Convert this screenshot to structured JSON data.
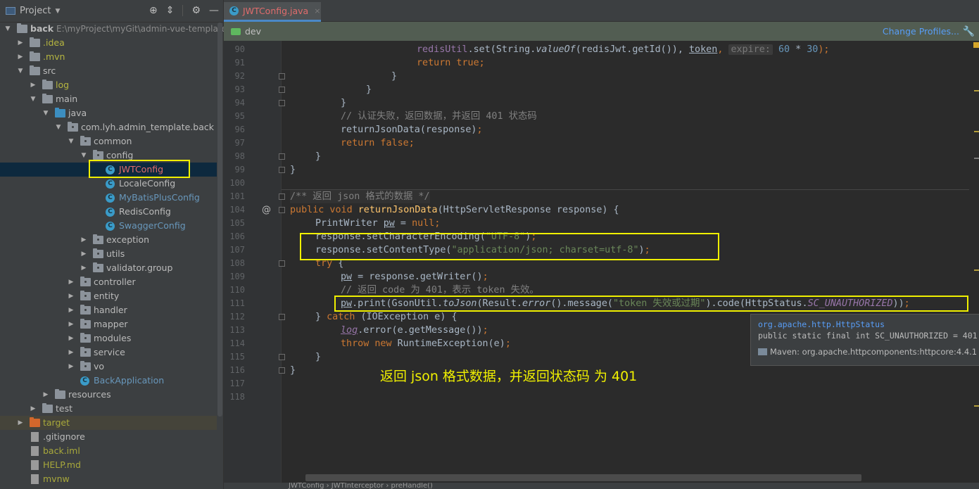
{
  "project_panel": {
    "title": "Project",
    "tools": [
      "locate-icon",
      "collapse-icon",
      "gear-icon",
      "minimize-icon"
    ],
    "tree": [
      {
        "label": "back",
        "path": "E:\\myProject\\myGit\\admin-vue-template\\b",
        "depth": 0,
        "expanded": true,
        "icon": "module"
      },
      {
        "label": ".idea",
        "depth": 1,
        "expanded": false,
        "icon": "folder",
        "color": "yellow"
      },
      {
        "label": ".mvn",
        "depth": 1,
        "expanded": false,
        "icon": "folder",
        "color": "yellow"
      },
      {
        "label": "src",
        "depth": 1,
        "expanded": true,
        "icon": "folder"
      },
      {
        "label": "log",
        "depth": 2,
        "expanded": false,
        "icon": "folder",
        "color": "yellow"
      },
      {
        "label": "main",
        "depth": 2,
        "expanded": true,
        "icon": "folder"
      },
      {
        "label": "java",
        "depth": 3,
        "expanded": true,
        "icon": "folder-blue"
      },
      {
        "label": "com.lyh.admin_template.back",
        "depth": 4,
        "expanded": true,
        "icon": "package"
      },
      {
        "label": "common",
        "depth": 5,
        "expanded": true,
        "icon": "package"
      },
      {
        "label": "config",
        "depth": 6,
        "expanded": true,
        "icon": "package"
      },
      {
        "label": "JWTConfig",
        "depth": 7,
        "icon": "class",
        "color": "red",
        "selected": true
      },
      {
        "label": "LocaleConfig",
        "depth": 7,
        "icon": "class"
      },
      {
        "label": "MyBatisPlusConfig",
        "depth": 7,
        "icon": "class",
        "color": "blue"
      },
      {
        "label": "RedisConfig",
        "depth": 7,
        "icon": "class"
      },
      {
        "label": "SwaggerConfig",
        "depth": 7,
        "icon": "class",
        "color": "blue"
      },
      {
        "label": "exception",
        "depth": 6,
        "expanded": false,
        "icon": "package"
      },
      {
        "label": "utils",
        "depth": 6,
        "expanded": false,
        "icon": "package"
      },
      {
        "label": "validator.group",
        "depth": 6,
        "expanded": false,
        "icon": "package"
      },
      {
        "label": "controller",
        "depth": 5,
        "expanded": false,
        "icon": "package"
      },
      {
        "label": "entity",
        "depth": 5,
        "expanded": false,
        "icon": "package"
      },
      {
        "label": "handler",
        "depth": 5,
        "expanded": false,
        "icon": "package"
      },
      {
        "label": "mapper",
        "depth": 5,
        "expanded": false,
        "icon": "package"
      },
      {
        "label": "modules",
        "depth": 5,
        "expanded": false,
        "icon": "package"
      },
      {
        "label": "service",
        "depth": 5,
        "expanded": false,
        "icon": "package"
      },
      {
        "label": "vo",
        "depth": 5,
        "expanded": false,
        "icon": "package"
      },
      {
        "label": "BackApplication",
        "depth": 5,
        "icon": "spring-class",
        "color": "blue"
      },
      {
        "label": "resources",
        "depth": 3,
        "expanded": false,
        "icon": "folder"
      },
      {
        "label": "test",
        "depth": 2,
        "expanded": false,
        "icon": "folder"
      },
      {
        "label": "target",
        "depth": 1,
        "expanded": false,
        "icon": "folder-orange",
        "color": "olive",
        "highlight": true
      },
      {
        "label": ".gitignore",
        "depth": 1,
        "icon": "file"
      },
      {
        "label": "back.iml",
        "depth": 1,
        "icon": "file",
        "color": "olive"
      },
      {
        "label": "HELP.md",
        "depth": 1,
        "icon": "file-md",
        "color": "olive"
      },
      {
        "label": "mvnw",
        "depth": 1,
        "icon": "file-exec",
        "color": "olive"
      }
    ]
  },
  "editor": {
    "tab": {
      "label": "JWTConfig.java",
      "close": "×"
    },
    "profile_bar": {
      "label": "dev",
      "link": "Change Profiles..."
    },
    "line_numbers": [
      "90",
      "91",
      "92",
      "93",
      "94",
      "95",
      "96",
      "97",
      "98",
      "99",
      "100",
      "101",
      "104",
      "105",
      "106",
      "107",
      "108",
      "109",
      "110",
      "111",
      "112",
      "113",
      "114",
      "115",
      "116",
      "117",
      "118"
    ],
    "code": {
      "l90": {
        "a": "redisUtil",
        "b": ".set(String.",
        "c": "valueOf",
        "d": "(redisJwt.getId()), ",
        "e": "token",
        "f": ", ",
        "g": "expire:",
        "h": " ",
        "i": "60",
        "j": " * ",
        "k": "30",
        "l": ");"
      },
      "l91": "return true;",
      "l92": "}",
      "l93": "}",
      "l94": "}",
      "l95": "// 认证失败，返回数据，并返回 401 状态码",
      "l96a": "returnJsonData(response)",
      "l96b": ";",
      "l97": "return false;",
      "l98": "}",
      "l99": "}",
      "l101": "/** 返回 json 格式的数据 */",
      "l104": {
        "kw": "public void ",
        "name": "returnJsonData",
        "rest": "(HttpServletResponse response) {"
      },
      "l105": {
        "a": "PrintWriter ",
        "b": "pw",
        "c": " = ",
        "d": "null",
        "e": ";"
      },
      "l106": {
        "a": "response.setCharacterEncoding(",
        "b": "\"UTF-8\"",
        "c": ")",
        "d": ";"
      },
      "l107": {
        "a": "response.setContentType(",
        "b": "\"application/json; charset=utf-8\"",
        "c": ")",
        "d": ";"
      },
      "l108": {
        "kw": "try",
        "rest": " {"
      },
      "l109": {
        "a": "pw",
        "b": " = response.getWriter()",
        "c": ";"
      },
      "l110": "// 返回 code 为 401，表示 token 失效。",
      "l111": {
        "a": "pw",
        "b": ".print(GsonUtil.",
        "c": "toJson",
        "d": "(Result.",
        "e": "error",
        "f": "().message(",
        "g": "\"token 失效或过期\"",
        "h": ").code(HttpStatus.",
        "i": "SC_UNAUTHORIZED",
        "j": "))",
        "k": ";"
      },
      "l112": {
        "a": "} ",
        "kw": "catch",
        "rest": " (IOException e) {"
      },
      "l113": {
        "a": "log",
        "b": ".error(e.getMessage())",
        "c": ";"
      },
      "l114": {
        "kw": "throw new ",
        "rest": "RuntimeException(e)",
        "c": ";"
      },
      "l115": "}",
      "l116": "}"
    },
    "tooltip": {
      "package": "org.apache.http.HttpStatus",
      "declaration": "public static final int SC_UNAUTHORIZED = 401",
      "source": "Maven: org.apache.httpcomponents:httpcore:4.4.1"
    },
    "annotation": "返回 json 格式数据，并返回状态码 为 401",
    "breadcrumb": "JWTConfig  ›  JWTInterceptor  ›  preHandle()"
  },
  "colors": {
    "highlight_box": "#f0f000",
    "keyword": "#cc7832",
    "string": "#6a8759",
    "number": "#6897bb",
    "field": "#9876aa",
    "comment": "#808080",
    "link": "#589df6"
  }
}
